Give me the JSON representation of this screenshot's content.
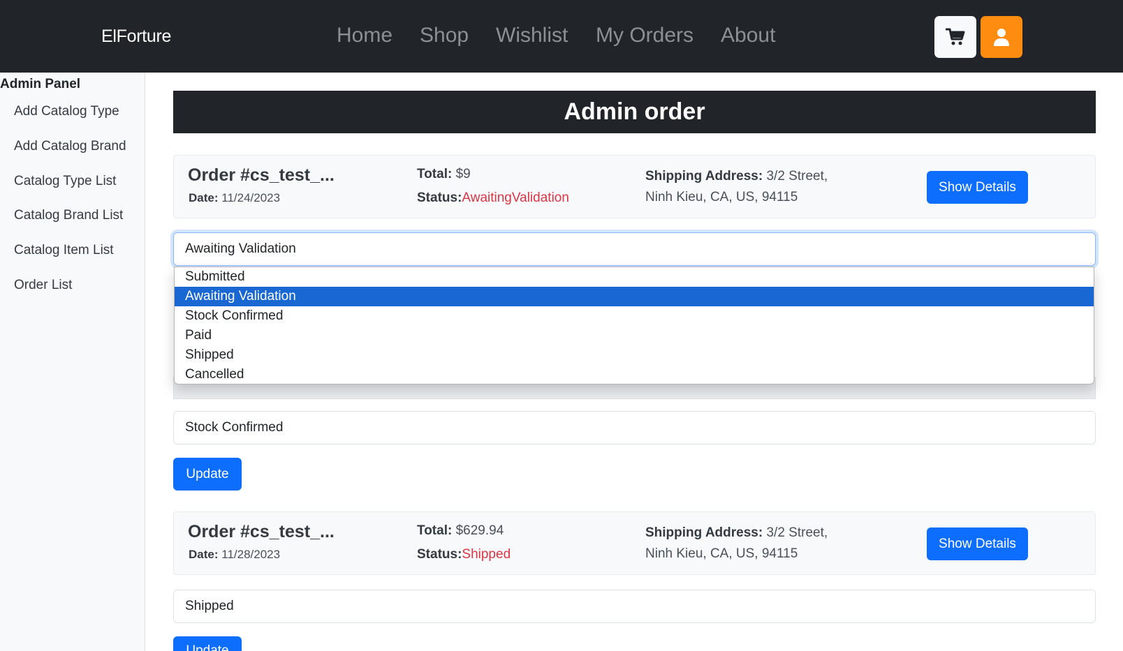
{
  "navbar": {
    "brand": "ElForture",
    "links": [
      "Home",
      "Shop",
      "Wishlist",
      "My Orders",
      "About"
    ],
    "icons": {
      "cart": "cart-icon",
      "user": "user-icon"
    },
    "colors": {
      "background": "#212529",
      "user_button": "#fd8c10"
    }
  },
  "sidebar": {
    "title": "Admin Panel",
    "items": [
      "Add Catalog Type",
      "Add Catalog Brand",
      "Catalog Type List",
      "Catalog Brand List",
      "Catalog Item List",
      "Order List"
    ]
  },
  "main": {
    "title": "Admin order",
    "labels": {
      "date": "Date:",
      "total": "Total:",
      "status": "Status:",
      "shipping": "Shipping Address:",
      "show_details": "Show Details",
      "update": "Update"
    },
    "orders": [
      {
        "id": "Order #cs_test_...",
        "date": "11/24/2023",
        "total": "$9",
        "status": "AwaitingValidation",
        "address_line1": "3/2 Street,",
        "address_line2": "Ninh Kieu, CA, US, 94115",
        "select_value": "Awaiting Validation"
      },
      {
        "id": "Order #cs_test_...",
        "date": "11/28/2023",
        "total": "$629.94",
        "status": "Shipped",
        "address_line1": "3/2 Street,",
        "address_line2": "Ninh Kieu, CA, US, 94115",
        "select_value": "Shipped"
      }
    ],
    "hidden_order_select_value": "Stock Confirmed",
    "dropdown": {
      "options": [
        "Submitted",
        "Awaiting Validation",
        "Stock Confirmed",
        "Paid",
        "Shipped",
        "Cancelled"
      ],
      "selected": "Awaiting Validation"
    },
    "colors": {
      "primary": "#0d6efd",
      "status": "#dc3545",
      "highlight": "#1967d2"
    }
  }
}
